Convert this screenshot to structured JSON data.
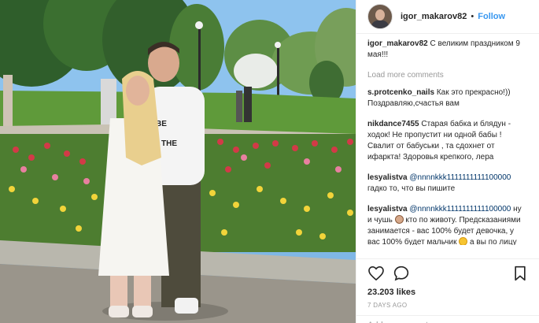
{
  "header": {
    "username": "igor_makarov82",
    "separator": "•",
    "follow_label": "Follow"
  },
  "caption": {
    "username": "igor_makarov82",
    "text": "С великим праздником 9 мая!!!"
  },
  "load_more": "Load more comments",
  "comments": [
    {
      "username": "s.protcenko_nails",
      "text": "Как это прекрасно!)) Поздравляю,счастья вам"
    },
    {
      "username": "nikdance7455",
      "text": "Старая бабка и блядун - ходок! Не пропустит ни одной бабы ! Свалит от бабуськи , та сдохнет от ифаркта! Здоровья крепкого, лера"
    },
    {
      "username": "lesyalistva",
      "mention": "@nnnnkkk1111111111100000",
      "text": "гадко то, что вы пишите"
    },
    {
      "username": "lesyalistva",
      "mention": "@nnnnkkk1111111111100000",
      "text_a": "ну и чушь",
      "text_b": "кто по животу. Предсказаниями занимается - вас 100% будет девочка, у вас 100% будет мальчик",
      "text_c": "а вы по лицу гадаете и пишите свои мерзкие комментарии беременной женщине. И вообще какое вам дело до нее? Пусть мелюдо себе катить"
    }
  ],
  "likes": "23.203 likes",
  "time_ago": "7 DAYS AGO",
  "add_comment_placeholder": "Add a comment...",
  "icons": {
    "like": "heart-icon",
    "comment": "comment-icon",
    "save": "bookmark-icon"
  },
  "photo": {
    "shirt_text": "BE THE ST"
  }
}
